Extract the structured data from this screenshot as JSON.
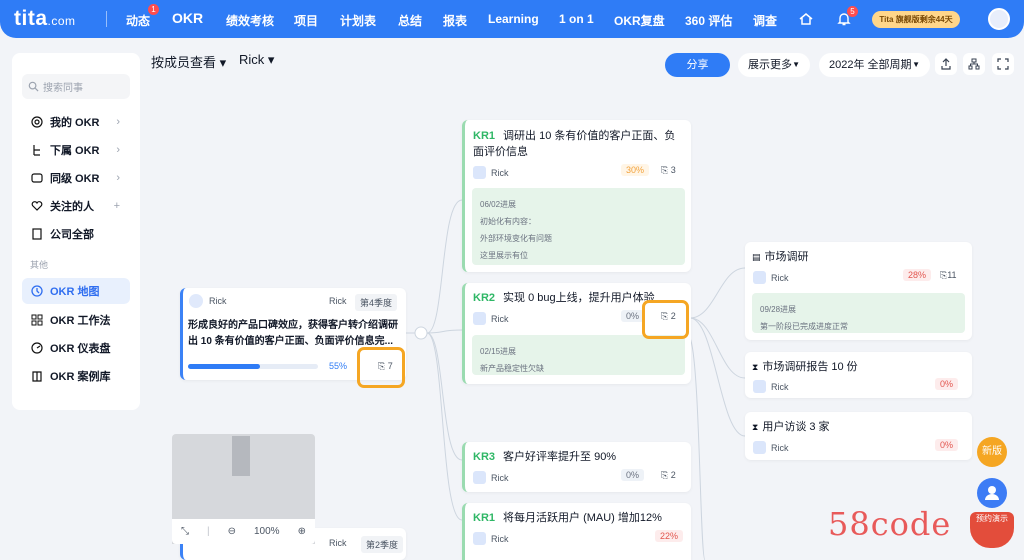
{
  "brand": {
    "logo_main": "tita",
    "logo_suffix": ".com"
  },
  "nav": {
    "items": [
      {
        "label": "动态",
        "badge": "1"
      },
      {
        "label": "OKR"
      },
      {
        "label": "绩效考核"
      },
      {
        "label": "项目"
      },
      {
        "label": "计划表"
      },
      {
        "label": "总结"
      },
      {
        "label": "报表"
      },
      {
        "label": "Learning"
      },
      {
        "label": "1 on 1"
      },
      {
        "label": "OKR复盘"
      },
      {
        "label": "360 评估"
      },
      {
        "label": "调查"
      }
    ],
    "bell_badge": "5",
    "promo": "Tita 旗舰版剩余44天"
  },
  "sidebar": {
    "search_placeholder": "搜索同事",
    "items": [
      {
        "label": "我的 OKR",
        "arrow": "›"
      },
      {
        "label": "下属 OKR",
        "arrow": "›"
      },
      {
        "label": "同级 OKR",
        "arrow": "›"
      },
      {
        "label": "关注的人",
        "arrow": "+"
      },
      {
        "label": "公司全部"
      }
    ],
    "section_label": "其他",
    "other_items": [
      {
        "label": "OKR 地图"
      },
      {
        "label": "OKR 工作法"
      },
      {
        "label": "OKR 仪表盘"
      },
      {
        "label": "OKR 案例库"
      }
    ]
  },
  "toolbar": {
    "viewer_label": "按成员查看 ▾",
    "member": "Rick ▾",
    "share": "分享",
    "display_more": "展示更多",
    "period": "2022年 全部周期"
  },
  "objective": {
    "owner": "Rick",
    "owner_tag": "Rick",
    "period": "第4季度",
    "title": "形成良好的产品口碑效应，获得客户转介绍调研出 10 条有价值的客户正面、负面评价信息完...",
    "progress": 0.55,
    "progress_label": "55%",
    "kr_count": "7"
  },
  "objective2": {
    "owner": "Rick",
    "period": "第2季度"
  },
  "krs": [
    {
      "tag": "KR1",
      "title": "调研出 10 条有价值的客户正面、负面评价信息",
      "owner": "Rick",
      "pct": "30%",
      "count": "3",
      "progress_date": "06/02进展",
      "progress_lines": [
        "初始化有内容：",
        "外部环境变化有问题",
        "这里展示有位"
      ]
    },
    {
      "tag": "KR2",
      "title": "实现 0 bug上线，提升用户体验",
      "owner": "Rick",
      "pct": "0%",
      "count": "2",
      "progress_date": "02/15进展",
      "progress_lines": [
        "新产品稳定性欠缺"
      ]
    },
    {
      "tag": "KR3",
      "title": "客户好评率提升至 90%",
      "owner": "Rick",
      "pct": "0%",
      "count": "2"
    },
    {
      "tag": "KR1",
      "title": "将每月活跃用户 (MAU) 增加12%",
      "owner": "Rick",
      "pct": "22%"
    }
  ],
  "tasks": [
    {
      "title": "市场调研",
      "owner": "Rick",
      "pct": "28%",
      "count": "11",
      "progress_date": "09/28进展",
      "progress_line": "第一阶段已完成进度正常"
    },
    {
      "title": "市场调研报告 10 份",
      "owner": "Rick",
      "pct": "0%"
    },
    {
      "title": "用户访谈 3 家",
      "owner": "Rick",
      "pct": "0%"
    }
  ],
  "minimap": {
    "zoom": "100%"
  },
  "floating": {
    "new_label": "新版",
    "demo_label": "预约演示"
  },
  "watermark": "58code",
  "colors": {
    "primary": "#2f7cf6",
    "kr_green": "#2fb766",
    "highlight": "#f5a623"
  }
}
